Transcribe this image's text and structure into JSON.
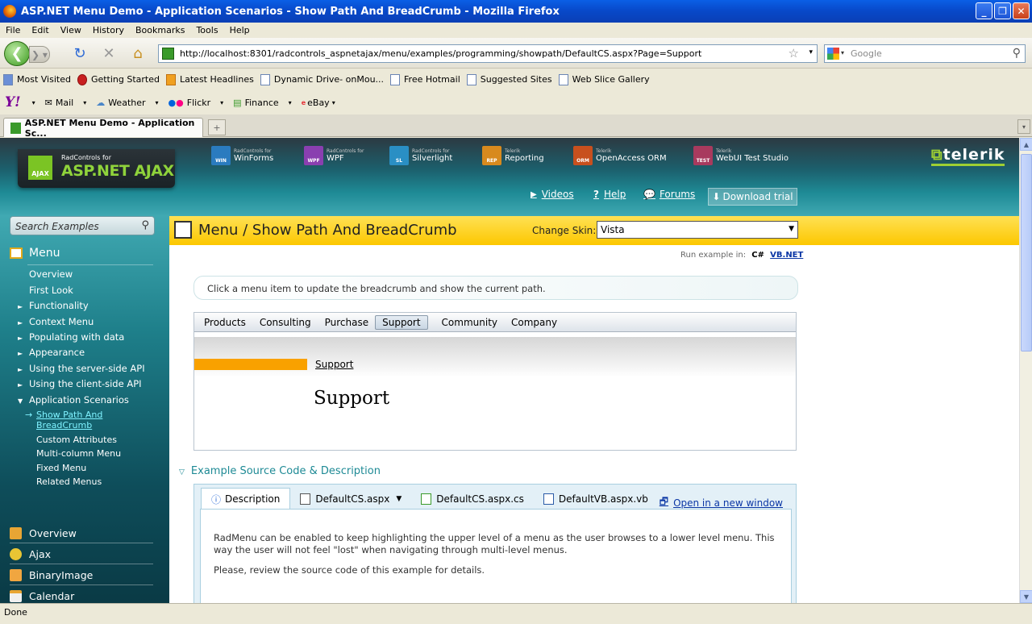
{
  "window": {
    "title": "ASP.NET Menu Demo - Application Scenarios - Show Path And BreadCrumb - Mozilla Firefox"
  },
  "menubar": [
    "File",
    "Edit",
    "View",
    "History",
    "Bookmarks",
    "Tools",
    "Help"
  ],
  "url": "http://localhost:8301/radcontrols_aspnetajax/menu/examples/programming/showpath/DefaultCS.aspx?Page=Support",
  "search_placeholder": "Google",
  "bookmarks": [
    "Most Visited",
    "Getting Started",
    "Latest Headlines",
    "Dynamic Drive- onMou...",
    "Free Hotmail",
    "Suggested Sites",
    "Web Slice Gallery"
  ],
  "yahoo": [
    "Mail",
    "Weather",
    "Flickr",
    "Finance",
    "eBay"
  ],
  "tab": {
    "title": "ASP.NET Menu Demo - Application Sc..."
  },
  "status": "Done",
  "header": {
    "logo_small": "RadControls for",
    "logo_big": "ASP.NET AJAX",
    "logo_badge": "AJAX",
    "products": [
      {
        "sub": "RadControls for",
        "name": "WinForms",
        "badge": "WIN",
        "color": "#2a7bbf"
      },
      {
        "sub": "RadControls for",
        "name": "WPF",
        "badge": "WPF",
        "color": "#8a3fb0"
      },
      {
        "sub": "RadControls for",
        "name": "Silverlight",
        "badge": "SL",
        "color": "#2a8fc4"
      },
      {
        "sub": "Telerik",
        "name": "Reporting",
        "badge": "REP",
        "color": "#d88a1e"
      },
      {
        "sub": "Telerik",
        "name": "OpenAccess ORM",
        "badge": "ORM",
        "color": "#c8501e"
      },
      {
        "sub": "Telerik",
        "name": "WebUI Test Studio",
        "badge": "TEST",
        "color": "#a83a5e"
      }
    ],
    "brand": "telerik",
    "links": [
      "Videos",
      "Help",
      "Forums"
    ],
    "download": "Download trial"
  },
  "sidebar": {
    "search": "Search Examples",
    "title": "Menu",
    "items": [
      {
        "label": "Overview",
        "arrow": ""
      },
      {
        "label": "First Look",
        "arrow": ""
      },
      {
        "label": "Functionality",
        "arrow": "►"
      },
      {
        "label": "Context Menu",
        "arrow": "►"
      },
      {
        "label": "Populating with data",
        "arrow": "►"
      },
      {
        "label": "Appearance",
        "arrow": "►"
      },
      {
        "label": "Using the server-side API",
        "arrow": "►"
      },
      {
        "label": "Using the client-side API",
        "arrow": "►"
      },
      {
        "label": "Application Scenarios",
        "arrow": "▼"
      }
    ],
    "subitems": [
      "Show Path And",
      "BreadCrumb",
      "Custom Attributes",
      "Multi-column Menu",
      "Fixed Menu",
      "Related Menus"
    ],
    "subarrow": "→",
    "categories": [
      {
        "label": "Overview",
        "color": "#e8a534"
      },
      {
        "label": "Ajax",
        "color": "#e8c534"
      },
      {
        "label": "BinaryImage",
        "color": "#f0a640"
      },
      {
        "label": "Calendar",
        "color": "#f0f0f0"
      }
    ]
  },
  "page": {
    "title": "Menu / Show Path And BreadCrumb",
    "skin_label": "Change Skin:",
    "skin_value": "Vista",
    "run_label": "Run example in:",
    "run_cs": "C#",
    "run_vb": "VB.NET",
    "info": "Click a menu item to update the breadcrumb and show the current path.",
    "demo_menu": [
      "Products",
      "Consulting",
      "Purchase",
      "Support",
      "Community",
      "Company"
    ],
    "breadcrumb": "Support",
    "current": "Support",
    "source_title": "Example Source Code & Description",
    "source_tabs": [
      "Description",
      "DefaultCS.aspx",
      "DefaultCS.aspx.cs",
      "DefaultVB.aspx.vb"
    ],
    "open_window": "Open in a new window",
    "desc1": "RadMenu can be enabled to keep highlighting the upper level of a menu as the user browses to a lower level menu. This way the user will not feel \"lost\" when navigating through multi-level menus.",
    "desc2": "Please, review the source code of this example for details."
  }
}
